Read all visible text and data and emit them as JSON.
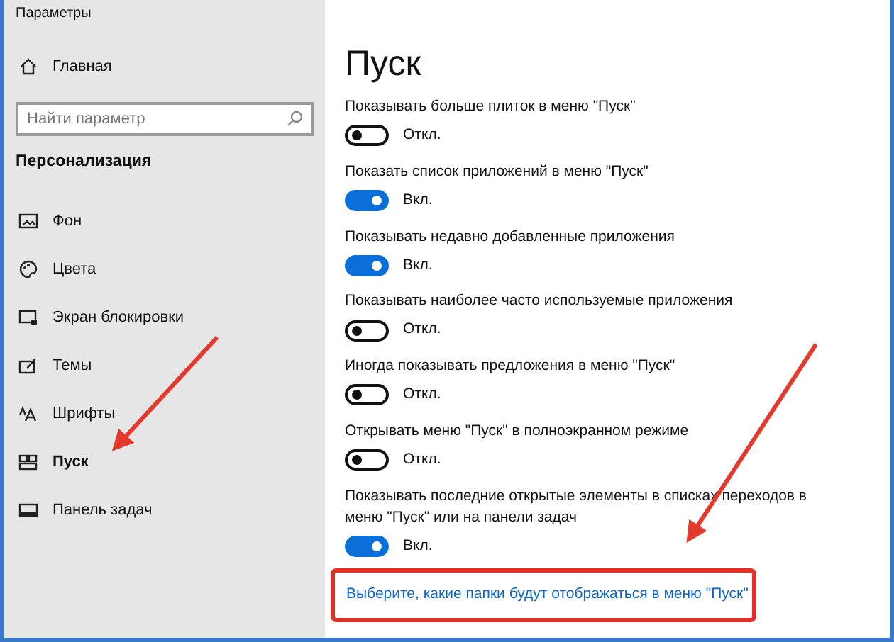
{
  "window": {
    "title": "Параметры"
  },
  "sidebar": {
    "home": "Главная",
    "search": {
      "placeholder": "Найти параметр"
    },
    "section": "Персонализация",
    "items": [
      {
        "label": "Фон",
        "selected": false
      },
      {
        "label": "Цвета",
        "selected": false
      },
      {
        "label": "Экран блокировки",
        "selected": false
      },
      {
        "label": "Темы",
        "selected": false
      },
      {
        "label": "Шрифты",
        "selected": false
      },
      {
        "label": "Пуск",
        "selected": true
      },
      {
        "label": "Панель задач",
        "selected": false
      }
    ]
  },
  "page": {
    "title": "Пуск",
    "settings": [
      {
        "label": "Показывать больше плиток в меню \"Пуск\"",
        "on": false,
        "state": "Откл."
      },
      {
        "label": "Показать список приложений в меню \"Пуск\"",
        "on": true,
        "state": "Вкл."
      },
      {
        "label": "Показывать недавно добавленные приложения",
        "on": true,
        "state": "Вкл."
      },
      {
        "label": "Показывать наиболее часто используемые приложения",
        "on": false,
        "state": "Откл."
      },
      {
        "label": "Иногда показывать предложения в меню \"Пуск\"",
        "on": false,
        "state": "Откл."
      },
      {
        "label": "Открывать меню \"Пуск\" в полноэкранном режиме",
        "on": false,
        "state": "Откл."
      },
      {
        "label": "Показывать последние открытые элементы в списках переходов в меню \"Пуск\" или на панели задач",
        "on": true,
        "state": "Вкл."
      }
    ],
    "link": "Выберите, какие папки будут отображаться в меню \"Пуск\""
  }
}
